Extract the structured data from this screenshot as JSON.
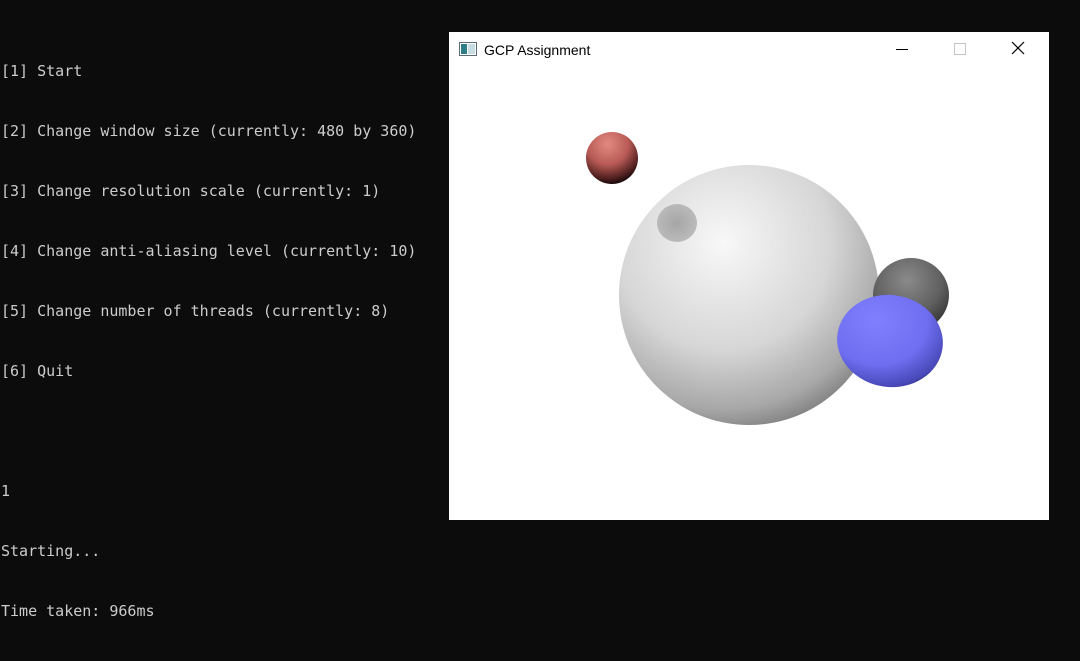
{
  "console": {
    "lines": [
      "[1] Start",
      "[2] Change window size (currently: 480 by 360)",
      "[3] Change resolution scale (currently: 1)",
      "[4] Change anti-aliasing level (currently: 10)",
      "[5] Change number of threads (currently: 8)",
      "[6] Quit",
      "",
      "1",
      "Starting...",
      "Time taken: 966ms"
    ]
  },
  "window": {
    "title": "GCP Assignment",
    "icon": "app-window-icon",
    "buttons": {
      "minimize_icon": "minimize-icon",
      "maximize_icon": "maximize-icon",
      "close_icon": "close-icon"
    }
  },
  "scene": {
    "objects": [
      {
        "name": "large-white-sphere",
        "color": "#f0f0f0"
      },
      {
        "name": "small-red-sphere",
        "color": "#d86060"
      },
      {
        "name": "gray-sphere",
        "color": "#6a6a6a"
      },
      {
        "name": "blue-sphere",
        "color": "#7878f8"
      }
    ]
  }
}
